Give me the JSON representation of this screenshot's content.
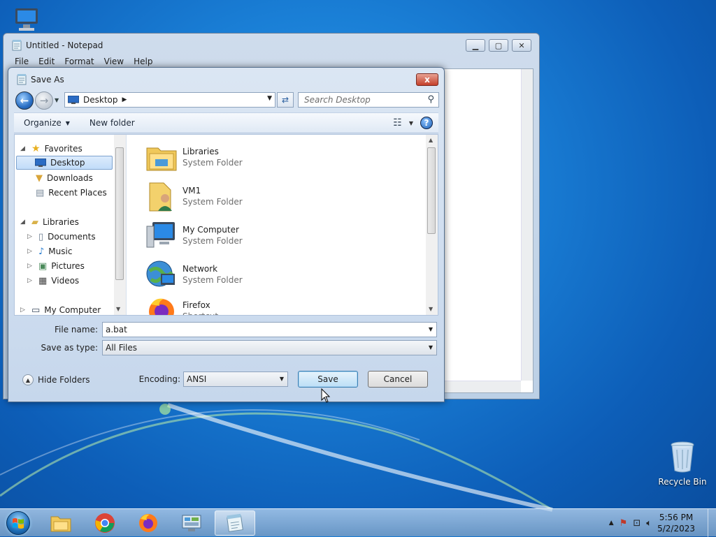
{
  "desktop": {
    "icons": [
      {
        "label": ""
      },
      {
        "label": "Recycle Bin"
      }
    ]
  },
  "notepad": {
    "title": "Untitled - Notepad",
    "menu": [
      "File",
      "Edit",
      "Format",
      "View",
      "Help"
    ]
  },
  "dialog": {
    "title": "Save As",
    "address": "Desktop",
    "search_placeholder": "Search Desktop",
    "toolbar": {
      "organize": "Organize",
      "new_folder": "New folder"
    },
    "tree": {
      "favorites": "Favorites",
      "favorites_items": [
        "Desktop",
        "Downloads",
        "Recent Places"
      ],
      "libraries": "Libraries",
      "libraries_items": [
        "Documents",
        "Music",
        "Pictures",
        "Videos"
      ],
      "my_computer": "My Computer"
    },
    "files": [
      {
        "name": "Libraries",
        "type": "System Folder",
        "icon": "libraries-icon"
      },
      {
        "name": "VM1",
        "type": "System Folder",
        "icon": "user-folder-icon"
      },
      {
        "name": "My Computer",
        "type": "System Folder",
        "icon": "computer-icon"
      },
      {
        "name": "Network",
        "type": "System Folder",
        "icon": "network-icon"
      },
      {
        "name": "Firefox",
        "type": "Shortcut",
        "icon": "firefox-icon"
      }
    ],
    "file_name_label": "File name:",
    "file_name_value": "a.bat",
    "save_type_label": "Save as type:",
    "save_type_value": "All Files",
    "hide_folders": "Hide Folders",
    "encoding_label": "Encoding:",
    "encoding_value": "ANSI",
    "save": "Save",
    "cancel": "Cancel",
    "close": "x"
  },
  "taskbar": {
    "time": "5:56 PM",
    "date": "5/2/2023"
  },
  "colors": {
    "desktop": "#1a7fd6",
    "close_red": "#c4402b",
    "selection": "#c1dcf9"
  }
}
